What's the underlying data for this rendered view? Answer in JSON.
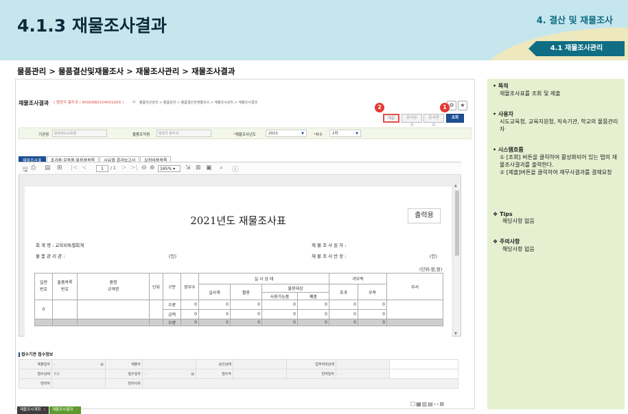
{
  "header": {
    "title": "4.1.3 재물조사결과",
    "section": "4. 결산 및 재물조사",
    "subsection": "4.1 재물조사관리"
  },
  "breadcrumb": "물품관리 > 물품결산및재물조사 > 재물조사관리 > 재물조사결과",
  "window": {
    "title": "재물조사결과",
    "user_info": "( 행정국 총무과 / A000AB0104001000 )",
    "nav_path": "물품자산관리 > 물품관리 > 물품결산및재물조사 > 재물조사관리 > 재물조사결과",
    "buttons": {
      "submit": "제출",
      "view_doc": "문서문서",
      "view_info": "문서정보",
      "search": "조회"
    },
    "badges": {
      "one": "1",
      "two": "2"
    }
  },
  "filter": {
    "org_label": "기관명",
    "org_value": "충청북도교육청",
    "dept_label": "물품조직명",
    "dept_value": "행정국 총무과",
    "year_label": "재물조사년도",
    "year_value": "2021",
    "round_label": "차수",
    "round_value": "1차"
  },
  "tabs": [
    "재물조사표",
    "초과품·부족품·불용품목록",
    "사유별 결과보고서",
    "요청비품목록"
  ],
  "viewer": {
    "page": "1",
    "pages": "/ 1",
    "zoom": "165%"
  },
  "document": {
    "title": "2021년도 재물조사표",
    "stamp": "출력용",
    "account_label": "회 계 명 : 교육비특별회계",
    "manager_label": "물 품 관 리 관 :",
    "seal1": "(인)",
    "investigator_label": "재 물 조 사 원 자 :",
    "supervisor_label": "재 물 조 사 반 장 :",
    "seal2": "(인)",
    "unit_note": "(단위:점,원)",
    "table": {
      "headers": {
        "serial": "일련\n번호",
        "item_no": "물품목록\n번호",
        "name": "품명\n규격명",
        "unit": "단위",
        "kind": "구분",
        "book": "장부수",
        "actual_group": "실 사 상 태",
        "actual": "실사계",
        "use": "활용",
        "disposal": "불용대상",
        "usable": "사용가능품",
        "waste": "폐품",
        "overshort": "과부족",
        "over": "초과",
        "short": "부족",
        "remark": "부서"
      },
      "rows": [
        {
          "serial": "0",
          "kind": "수량",
          "book": "0",
          "actual": "0",
          "use": "0",
          "usable": "0",
          "waste": "0",
          "over": "0",
          "short": "0"
        },
        {
          "serial": "",
          "kind": "금액",
          "book": "0",
          "actual": "0",
          "use": "0",
          "usable": "0",
          "waste": "0",
          "over": "0",
          "short": "0"
        },
        {
          "serial": "",
          "kind": "수량",
          "book": "0",
          "actual": "0",
          "use": "0",
          "usable": "0",
          "waste": "0",
          "over": "0",
          "short": "0"
        }
      ]
    }
  },
  "receipt": {
    "title": "접수기관 접수정보",
    "rows": [
      [
        {
          "l": "제출일자",
          "v": "- -"
        },
        {
          "l": "제출자",
          "v": ""
        },
        {
          "l": "승인상태",
          "v": ""
        },
        {
          "l": "업무처리상태",
          "v": ""
        }
      ],
      [
        {
          "l": "접수상태",
          "v": "정동"
        },
        {
          "l": "접수일자",
          "v": "- -"
        },
        {
          "l": "접수자",
          "v": ""
        },
        {
          "l": "반려일자",
          "v": "- -"
        }
      ],
      [
        {
          "l": "반려자",
          "v": ""
        },
        {
          "l": "반려사유",
          "v": ""
        }
      ]
    ]
  },
  "bottom_tabs": [
    {
      "label": "재물조사계획",
      "close": "×"
    },
    {
      "label": "재물조사결과",
      "close": "×"
    }
  ],
  "side": {
    "purpose_title": "목적",
    "purpose_text": "재물조사표를 조회 및 제출",
    "user_title": "사용자",
    "user_text": "시도교육청, 교육지원청, 직속기관, 학교의 물품관리자",
    "flow_title": "시스템흐름",
    "flow_1": "① [조회] 버튼을 클릭하여 활성화되어 있는 탭의 재물조사결과를 출력한다.",
    "flow_2": "② [제출]버튼을 클릭하여 재무사결과를 결재요청",
    "tips_title": "Tips",
    "tips_text": "해당사항 없음",
    "caution_title": "주의사항",
    "caution_text": "해당사항 없음"
  },
  "colors": {
    "header_bg": "#c6e6ee",
    "accent": "#0f6e84",
    "primary_btn": "#1c4f96",
    "side_bg": "#e6f0d0",
    "badge": "#e53935"
  }
}
